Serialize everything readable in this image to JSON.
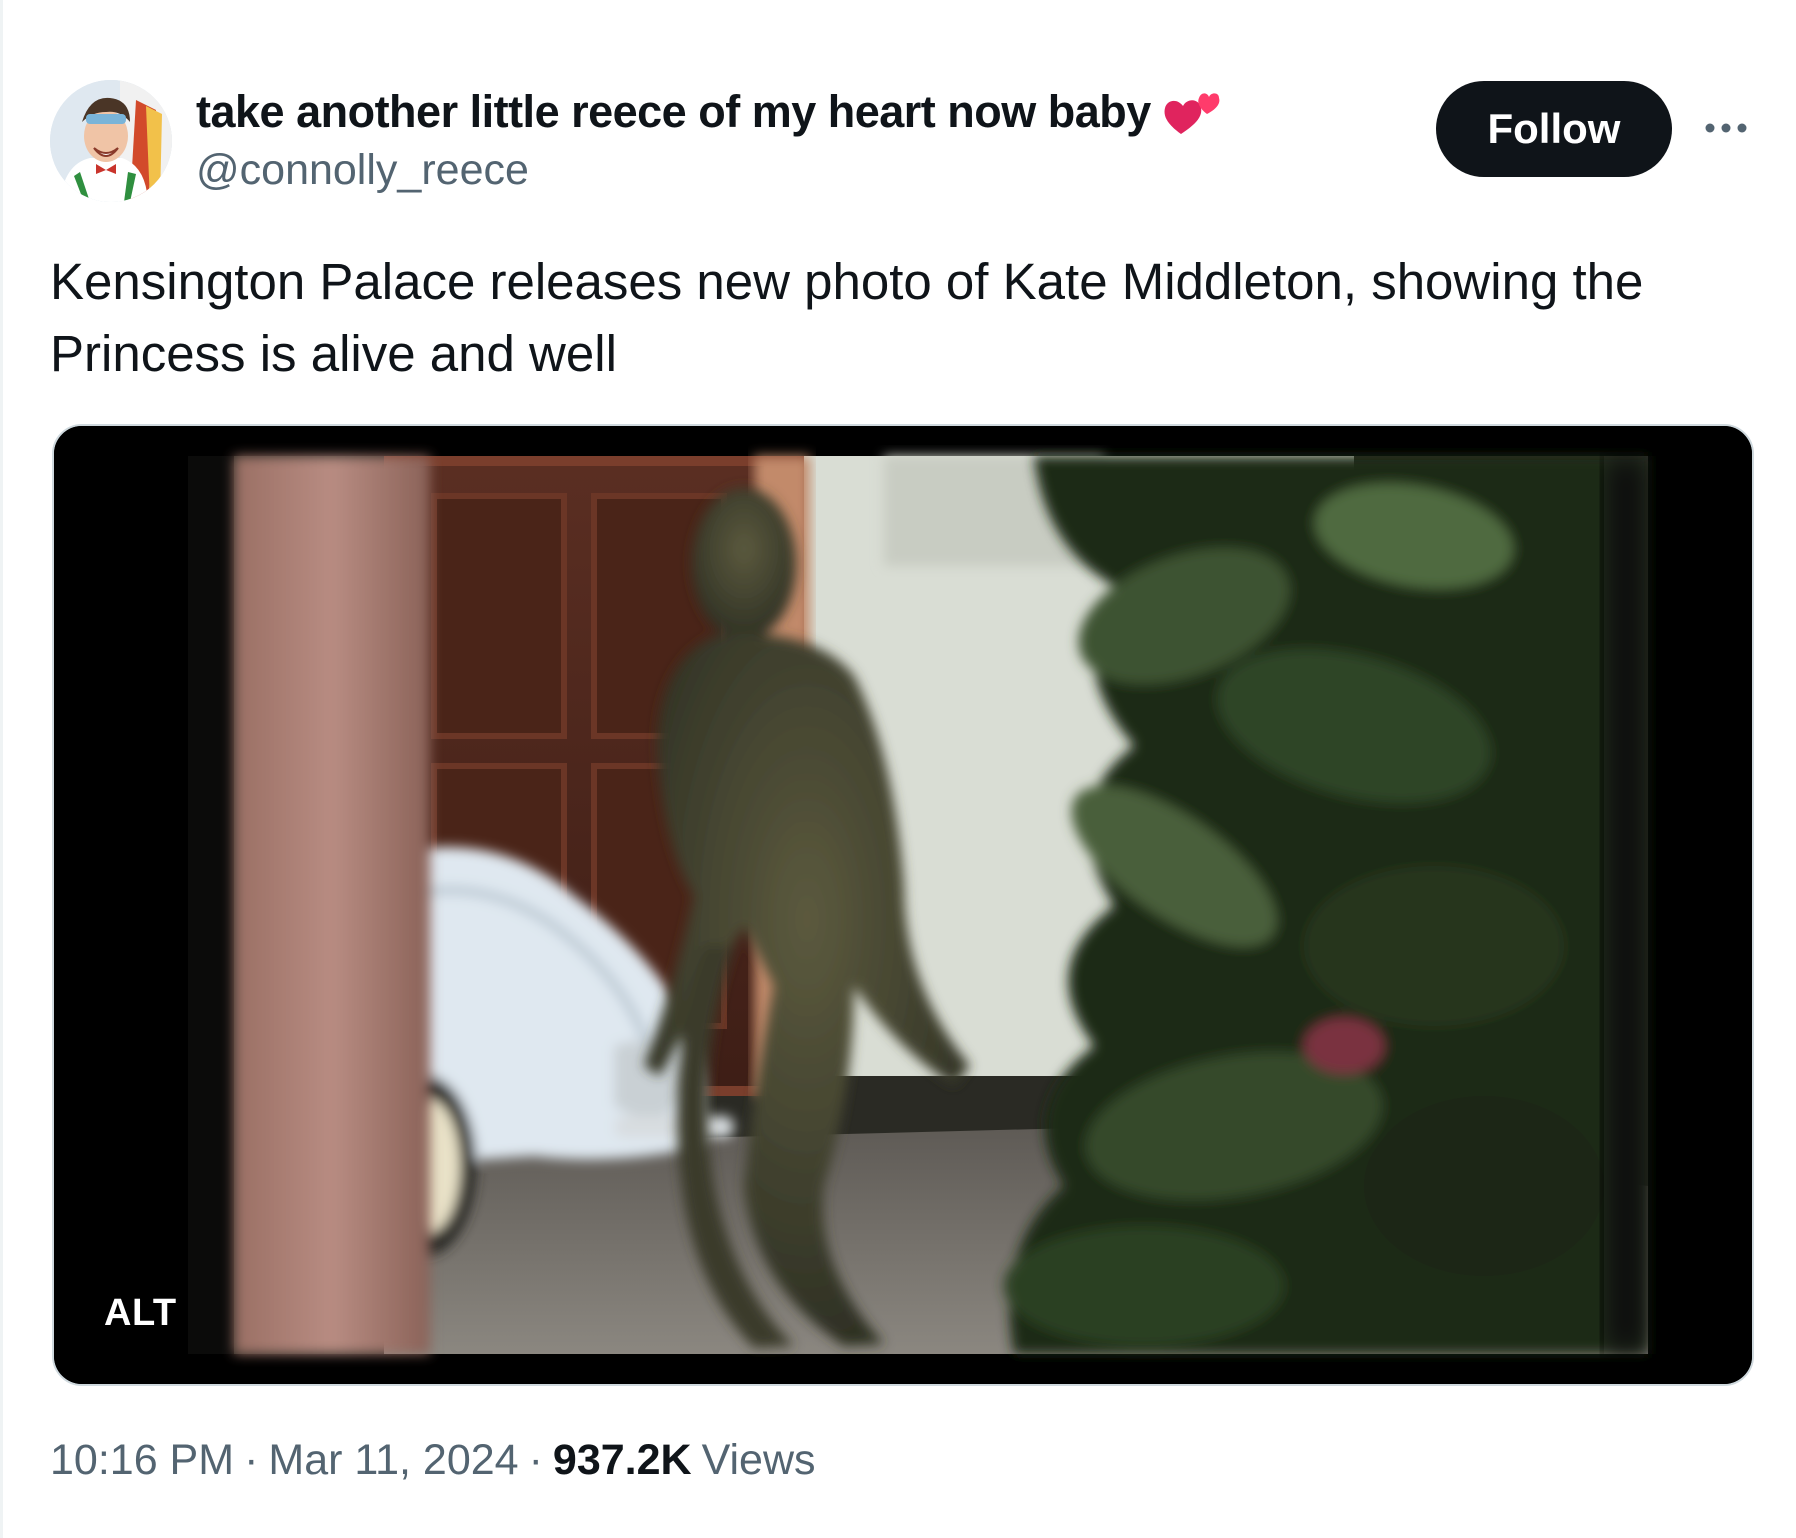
{
  "author": {
    "display_name": "take another little reece of my heart now baby",
    "emoji_icon": "two-hearts-icon",
    "handle": "@connolly_reece",
    "avatar_icon": "avatar"
  },
  "follow_label": "Follow",
  "more_icon": "more-horizontal-icon",
  "tweet": {
    "text": "Kensington Palace releases new photo of Kate Middleton, showing the Princess is alive and well"
  },
  "media": {
    "alt_badge": "ALT"
  },
  "meta": {
    "time": "10:16 PM",
    "separator": "·",
    "date": "Mar 11, 2024",
    "views_count": "937.2K",
    "views_label": "Views"
  },
  "colors": {
    "text_primary": "#0f1419",
    "text_secondary": "#536471",
    "follow_bg": "#0f1419",
    "heart": "#e0245e"
  }
}
